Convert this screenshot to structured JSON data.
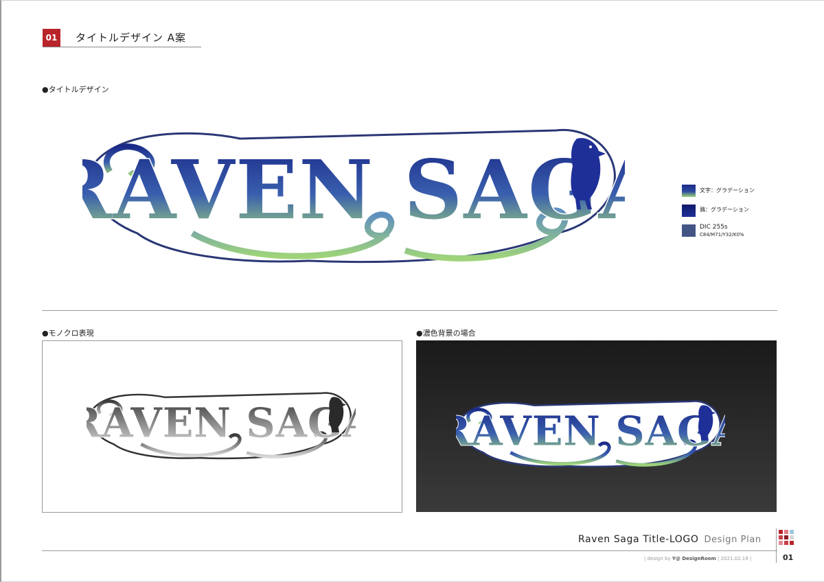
{
  "header": {
    "number": "01",
    "title": "タイトルデザイン  A案"
  },
  "sections": {
    "title_design": "●タイトルデザイン",
    "mono": "●モノクロ表現",
    "dark_bg": "●濃色背景の場合"
  },
  "logo": {
    "text": "RAVEN SAGA"
  },
  "colors": {
    "text_gradient_top": "#1a2a88",
    "text_gradient_bottom": "#9fd47a",
    "raven": "#1f2f98",
    "dic": "#435585",
    "outline": "#2a3775"
  },
  "swatches": [
    {
      "label": "文字：グラデーション"
    },
    {
      "label": "鴉：グラデーション"
    },
    {
      "label": "DIC 255s",
      "sub": "C84/M71/Y32/K0%"
    }
  ],
  "footer": {
    "title": "Raven Saga Title-LOGO",
    "subtitle": "Design Plan",
    "meta_prefix": "|   design by ",
    "meta_author": "Y@ DesignRoom",
    "meta_suffix": "   |   2021.02.19   |",
    "page": "01"
  }
}
